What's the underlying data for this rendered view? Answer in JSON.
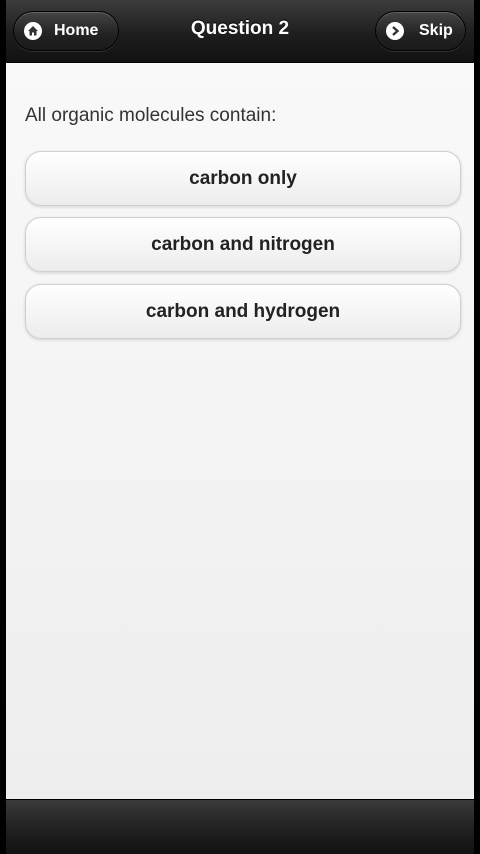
{
  "header": {
    "title": "Question 2",
    "home_label": "Home",
    "skip_label": "Skip",
    "home_icon": "home-icon",
    "skip_icon": "chevron-right-icon"
  },
  "question": {
    "text": "All organic molecules contain:"
  },
  "answers": [
    {
      "label": "carbon only"
    },
    {
      "label": "carbon and nitrogen"
    },
    {
      "label": "carbon and hydrogen"
    }
  ],
  "colors": {
    "header_bg": "#1e1e1e",
    "content_bg": "#f4f4f4",
    "answer_text": "#222222"
  }
}
